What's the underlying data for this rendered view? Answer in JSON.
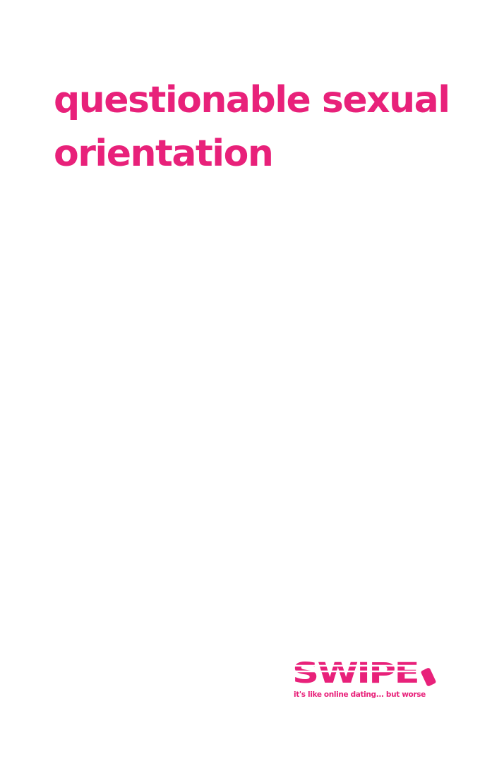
{
  "card": {
    "title": "questionable sexual orientation"
  },
  "brand": {
    "logo_text": "SWIPE",
    "tagline": "it's like online dating... but worse"
  },
  "colors": {
    "accent": "#e8217a",
    "background": "#ffffff"
  },
  "icons": {
    "logo": "swipe-logo-with-phone-icon"
  }
}
